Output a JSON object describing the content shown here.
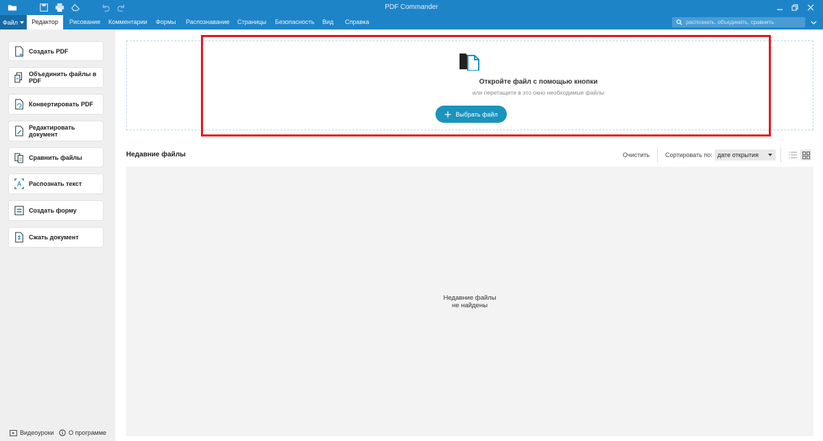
{
  "app": {
    "title": "PDF Commander"
  },
  "ribbon": {
    "file_label": "Файл",
    "tabs": [
      "Редактор",
      "Рисование",
      "Комментарии",
      "Формы",
      "Распознавание",
      "Страницы",
      "Безопасность",
      "Вид",
      "Справка"
    ],
    "active_tab": "Редактор",
    "search_placeholder": "распознать, объединить, сравнить"
  },
  "sidebar": {
    "items": [
      {
        "label": "Создать PDF",
        "icon": "create-pdf-icon"
      },
      {
        "label": "Объединить файлы в PDF",
        "icon": "merge-files-icon"
      },
      {
        "label": "Конвертировать PDF",
        "icon": "convert-pdf-icon"
      },
      {
        "label": "Редактировать документ",
        "icon": "edit-document-icon"
      },
      {
        "label": "Сравнить файлы",
        "icon": "compare-files-icon"
      },
      {
        "label": "Распознать текст",
        "icon": "ocr-text-icon"
      },
      {
        "label": "Создать форму",
        "icon": "create-form-icon"
      },
      {
        "label": "Сжать документ",
        "icon": "compress-document-icon"
      }
    ],
    "footer": {
      "tutorials": "Видеоуроки",
      "about": "О программе"
    }
  },
  "dropzone": {
    "title": "Откройте файл с помощью кнопки",
    "subtitle": "или перетащите в это окно необходимые файлы",
    "button": "Выбрать файл"
  },
  "recent": {
    "title": "Недавние файлы",
    "clear": "Очистить",
    "sort_label": "Сортировать по:",
    "sort_value": "дате открытия",
    "empty_line1": "Недавние файлы",
    "empty_line2": "не найдены"
  },
  "colors": {
    "accent": "#1e84c8",
    "button": "#1a93bd",
    "highlight": "#e8141c"
  }
}
